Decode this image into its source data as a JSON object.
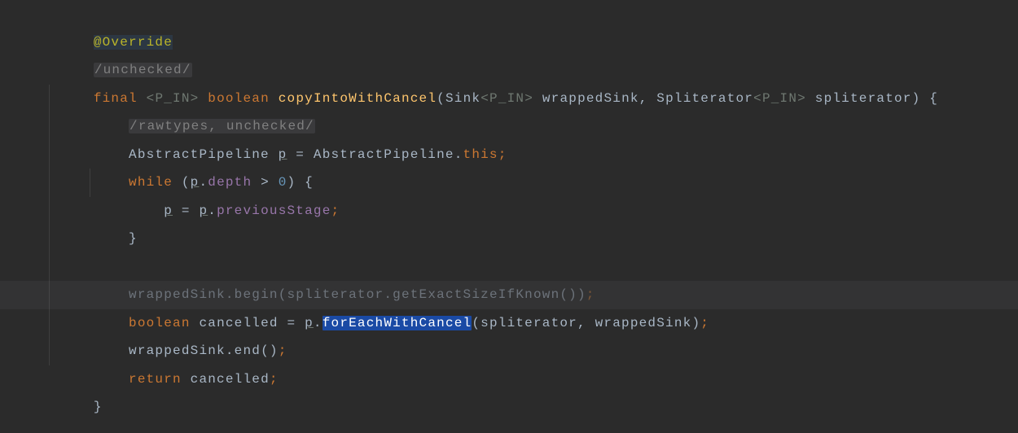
{
  "code": {
    "l0": {
      "ann": "@Override"
    },
    "l1": {
      "cmt": "/unchecked/"
    },
    "l2": {
      "kw_final": "final",
      "lt1": "<",
      "tp1": "P_IN",
      "gt1": ">",
      "kw_bool": "boolean",
      "method": "copyIntoWithCancel",
      "op": "(",
      "cls_sink": "Sink",
      "lt2": "<",
      "tp2": "P_IN",
      "gt2": ">",
      "param1": "wrappedSink",
      "comma1": ", ",
      "cls_spl": "Spliterator",
      "lt3": "<",
      "tp3": "P_IN",
      "gt3": ">",
      "param2": "spliterator",
      "cp": ")",
      "ob": "{"
    },
    "l3": {
      "cmt": "/rawtypes, unchecked/"
    },
    "l4": {
      "cls": "AbstractPipeline",
      "var": "p",
      "eq": " = ",
      "cls2": "AbstractPipeline",
      "dot": ".",
      "this": "this",
      "semi": ";"
    },
    "l5": {
      "kw": "while",
      "op": " (",
      "p": "p",
      "dot": ".",
      "fld": "depth",
      "cmp": " > ",
      "num": "0",
      "cp": ") {"
    },
    "l6": {
      "p1": "p",
      "eq": " = ",
      "p2": "p",
      "dot": ".",
      "fld": "previousStage",
      "semi": ";"
    },
    "l7": {
      "cb": "}"
    },
    "l9": {
      "ws": "wrappedSink",
      "dot": ".",
      "begin": "begin",
      "op": "(",
      "spl": "spliterator",
      "dot2": ".",
      "ges": "getExactSizeIfKnown",
      "cp": "())",
      "semi": ";"
    },
    "l10": {
      "kw": "boolean",
      "var": "cancelled",
      "eq": " = ",
      "p": "p",
      "dot": ".",
      "fec": "forEachWithCancel",
      "op": "(",
      "spl": "spliterator",
      "comma": ", ",
      "ws": "wrappedSink",
      "cp": ")",
      "semi": ";"
    },
    "l11": {
      "ws": "wrappedSink",
      "dot": ".",
      "end": "end",
      "op": "()",
      "semi": ";"
    },
    "l12": {
      "kw": "return",
      "sp": " ",
      "var": "cancelled",
      "semi": ";"
    },
    "l13": {
      "cb": "}"
    }
  }
}
